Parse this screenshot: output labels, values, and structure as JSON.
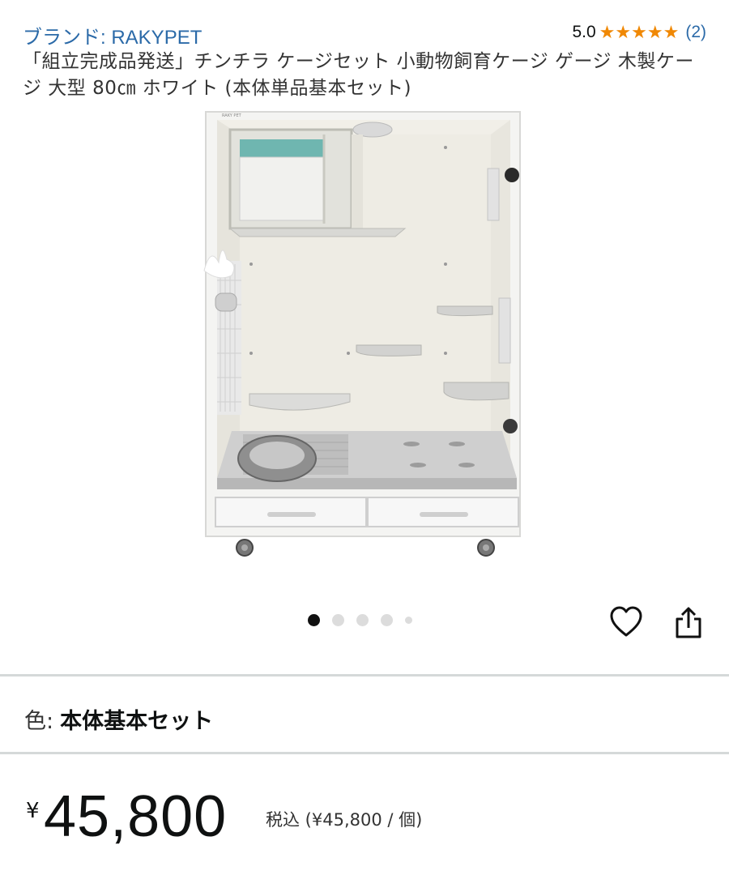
{
  "header": {
    "brand": "ブランド: RAKYPET",
    "rating_score": "5.0",
    "rating_stars": 5,
    "rating_count": "(2)"
  },
  "product": {
    "title": "「組立完成品発送」チンチラ ケージセット 小動物飼育ケージ ゲージ 木製ケージ 大型 80㎝ ホワイト (本体単品基本セット)",
    "image_label": "RAKY PET",
    "carousel": {
      "count": 5,
      "active_index": 0
    }
  },
  "actions": {
    "wishlist_icon": "heart-outline-icon",
    "share_icon": "share-icon"
  },
  "variant": {
    "label": "色:",
    "value": "本体基本セット"
  },
  "price": {
    "currency": "¥",
    "amount": "45,800",
    "note": "税込 (¥45,800 / 個)"
  },
  "colors": {
    "link": "#2b6aa8",
    "star": "#f08804",
    "divider": "#d5d9d9"
  }
}
